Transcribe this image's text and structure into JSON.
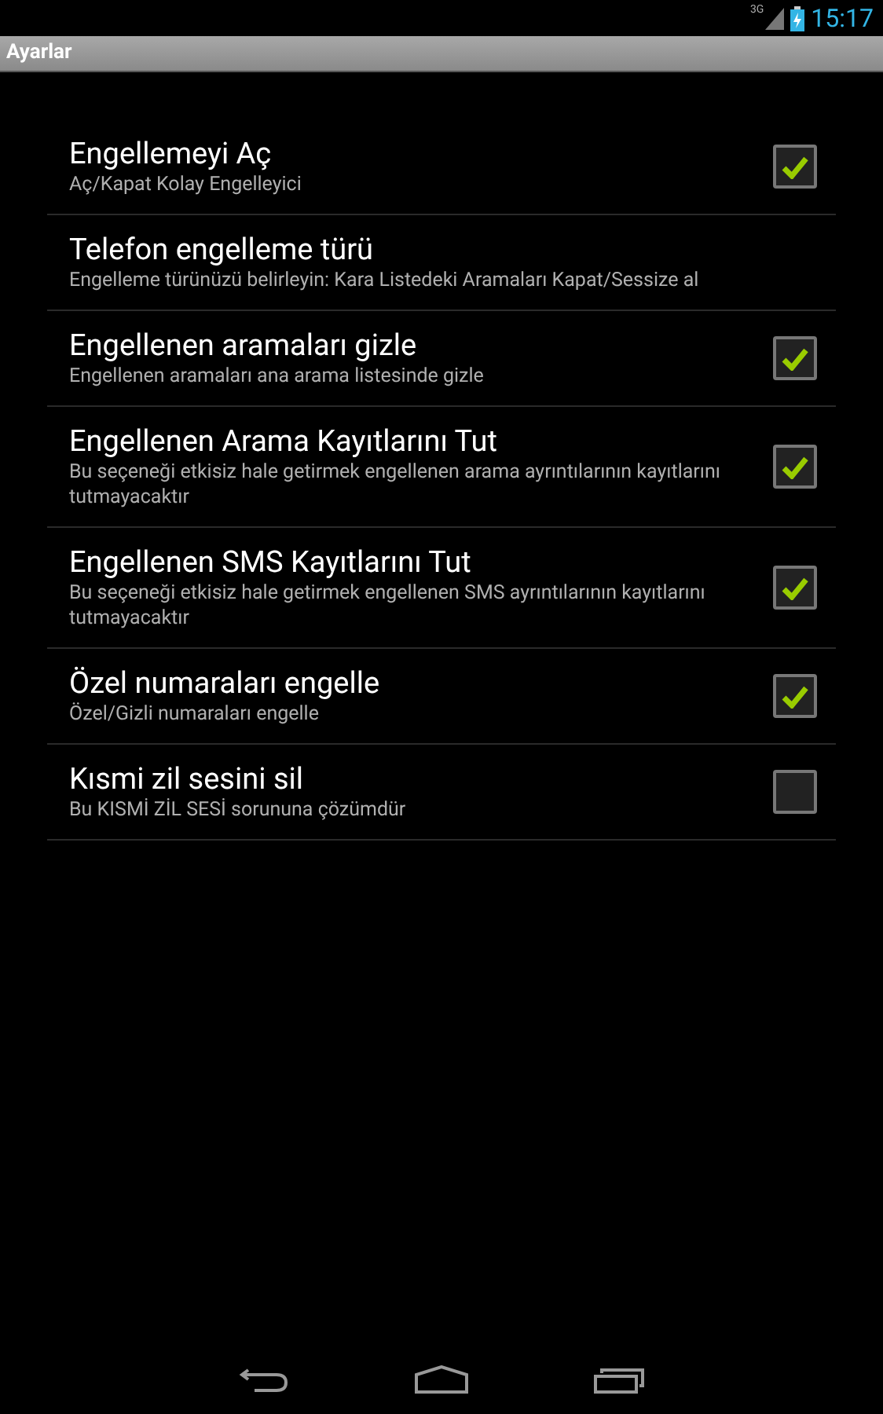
{
  "status_bar": {
    "network": "3G",
    "time": "15:17"
  },
  "title_bar": {
    "title": "Ayarlar"
  },
  "settings": [
    {
      "kind": "checkbox",
      "title": "Engellemeyi Aç",
      "summary": "Aç/Kapat Kolay Engelleyici",
      "checked": true
    },
    {
      "kind": "plain",
      "title": "Telefon engelleme türü",
      "summary": "Engelleme türünüzü belirleyin: Kara Listedeki Aramaları Kapat/Sessize al"
    },
    {
      "kind": "checkbox",
      "title": "Engellenen aramaları gizle",
      "summary": "Engellenen aramaları ana arama listesinde gizle",
      "checked": true
    },
    {
      "kind": "checkbox",
      "title": "Engellenen Arama Kayıtlarını Tut",
      "summary": "Bu seçeneği etkisiz hale getirmek engellenen arama ayrıntılarının kayıtlarını tutmayacaktır",
      "checked": true
    },
    {
      "kind": "checkbox",
      "title": "Engellenen SMS Kayıtlarını Tut",
      "summary": "Bu seçeneği etkisiz hale getirmek engellenen SMS ayrıntılarının kayıtlarını tutmayacaktır",
      "checked": true
    },
    {
      "kind": "checkbox",
      "title": "Özel numaraları engelle",
      "summary": "Özel/Gizli numaraları engelle",
      "checked": true
    },
    {
      "kind": "checkbox",
      "title": "Kısmi zil sesini sil",
      "summary": "Bu KISMİ ZİL SESİ sorununa çözümdür",
      "checked": false
    }
  ]
}
